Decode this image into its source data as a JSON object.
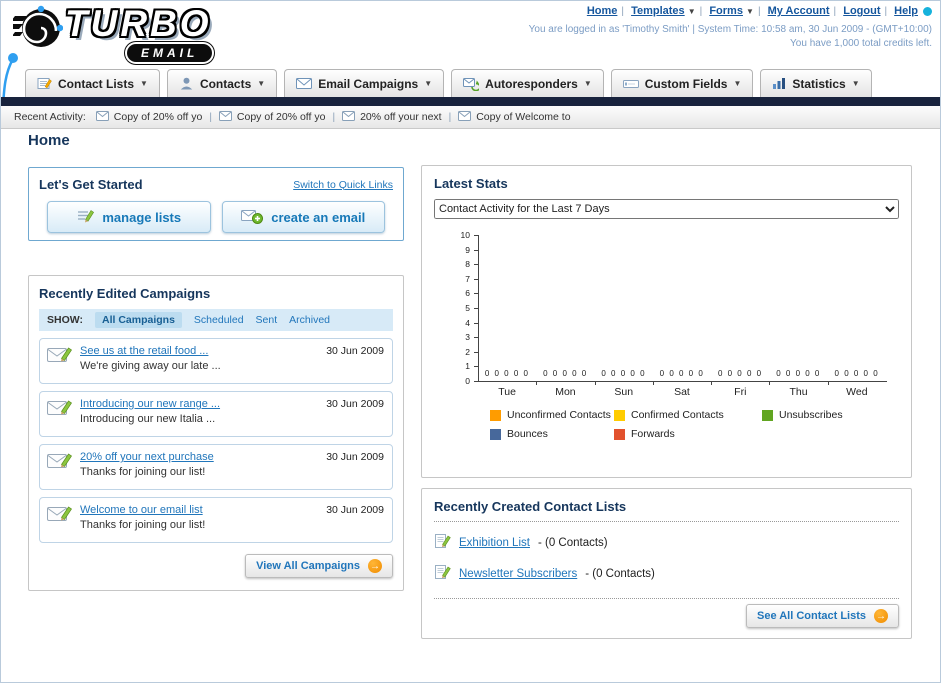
{
  "header": {
    "logo_line1": "TURBO",
    "logo_line2": "EMAIL",
    "links": [
      {
        "label": "Home"
      },
      {
        "label": "Templates"
      },
      {
        "label": "Forms"
      },
      {
        "label": "My Account"
      },
      {
        "label": "Logout"
      },
      {
        "label": "Help"
      }
    ],
    "login_info": "You are logged in as 'Timothy Smith' | System Time: 10:58 am, 30 Jun 2009 - (GMT+10:00)",
    "credits_info": "You have 1,000 total credits left."
  },
  "nav": {
    "items": [
      {
        "label": "Contact Lists"
      },
      {
        "label": "Contacts"
      },
      {
        "label": "Email Campaigns"
      },
      {
        "label": "Autoresponders"
      },
      {
        "label": "Custom Fields"
      },
      {
        "label": "Statistics"
      }
    ]
  },
  "activity": {
    "label": "Recent Activity:",
    "items": [
      {
        "label": "Copy of 20% off yo"
      },
      {
        "label": "Copy of 20% off yo"
      },
      {
        "label": "20% off your next"
      },
      {
        "label": "Copy of Welcome to"
      }
    ]
  },
  "page": {
    "title": "Home"
  },
  "get_started": {
    "title": "Let's Get Started",
    "switch_link": "Switch to Quick Links",
    "manage_lists_label": "manage lists",
    "create_email_label": "create an email"
  },
  "campaigns": {
    "title": "Recently Edited Campaigns",
    "show_label": "SHOW:",
    "tabs": [
      {
        "label": "All Campaigns"
      },
      {
        "label": "Scheduled"
      },
      {
        "label": "Sent"
      },
      {
        "label": "Archived"
      }
    ],
    "active_tab": "All Campaigns",
    "items": [
      {
        "title": "See us at the retail food ...",
        "subtitle": "We're giving away our late ...",
        "date": "30 Jun 2009"
      },
      {
        "title": "Introducing our new range ...",
        "subtitle": "Introducing our new Italia ...",
        "date": "30 Jun 2009"
      },
      {
        "title": "20% off your next purchase",
        "subtitle": "Thanks for joining our list!",
        "date": "30 Jun 2009"
      },
      {
        "title": "Welcome to our email list",
        "subtitle": "Thanks for joining our list!",
        "date": "30 Jun 2009"
      }
    ],
    "view_all_label": "View All Campaigns"
  },
  "stats": {
    "title": "Latest Stats",
    "selected_option": "Contact Activity for the Last 7 Days"
  },
  "chart_data": {
    "type": "bar",
    "categories": [
      "Tue",
      "Mon",
      "Sun",
      "Sat",
      "Fri",
      "Thu",
      "Wed"
    ],
    "series": [
      {
        "name": "Unconfirmed Contacts",
        "color": "#FF9C00",
        "values": [
          0,
          0,
          0,
          0,
          0,
          0,
          0
        ]
      },
      {
        "name": "Confirmed Contacts",
        "color": "#FFCC00",
        "values": [
          0,
          0,
          0,
          0,
          0,
          0,
          0
        ]
      },
      {
        "name": "Unsubscribes",
        "color": "#61A521",
        "values": [
          0,
          0,
          0,
          0,
          0,
          0,
          0
        ]
      },
      {
        "name": "Bounces",
        "color": "#47689B",
        "values": [
          0,
          0,
          0,
          0,
          0,
          0,
          0
        ]
      },
      {
        "name": "Forwards",
        "color": "#E2512D",
        "values": [
          0,
          0,
          0,
          0,
          0,
          0,
          0
        ]
      }
    ],
    "ylim": [
      0,
      10
    ],
    "yticks": [
      0,
      1,
      2,
      3,
      4,
      5,
      6,
      7,
      8,
      9,
      10
    ],
    "legend_position": "bottom",
    "grid": false
  },
  "contact_lists": {
    "title": "Recently Created Contact Lists",
    "items": [
      {
        "name": "Exhibition List",
        "suffix": "- (0 Contacts)"
      },
      {
        "name": "Newsletter Subscribers",
        "suffix": "- (0 Contacts)"
      }
    ],
    "see_all_label": "See All Contact Lists"
  }
}
